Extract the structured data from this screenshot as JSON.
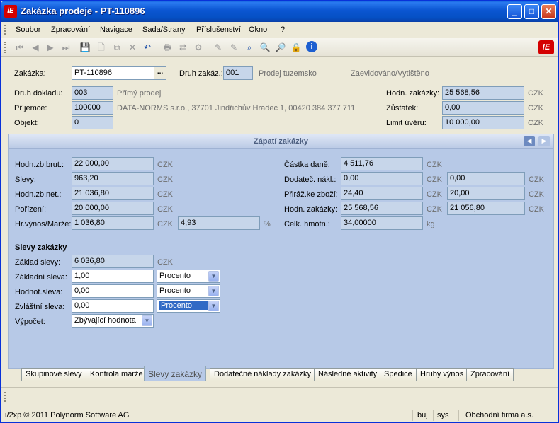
{
  "window": {
    "title": "Zakázka prodeje - PT-110896",
    "icon_text": "iE",
    "buttons": {
      "minimize": "_",
      "maximize": "□",
      "close": "✕"
    }
  },
  "menu": [
    "Soubor",
    "Zpracování",
    "Navigace",
    "Sada/Strany",
    "Příslušenství",
    "Okno",
    "?"
  ],
  "toolbar": {
    "icons": [
      "first-icon",
      "prev-icon",
      "next-icon",
      "last-icon",
      "save-icon",
      "new-icon",
      "copy-icon",
      "delete-icon",
      "undo-icon",
      "print-icon",
      "transfer-icon",
      "settings-icon",
      "edit-icon",
      "edit2-icon",
      "search-icon",
      "zoom-icon",
      "zoom-text-icon",
      "lock-icon",
      "info-icon"
    ],
    "logo_text": "iE"
  },
  "header": {
    "zakazka_label": "Zakázka:",
    "zakazka_value": "PT-110896",
    "druh_zakaz_label": "Druh zakáz.:",
    "druh_zakaz_value": "001",
    "druh_zakaz_desc": "Prodej tuzemsko",
    "status_text": "Zaevidováno/Vytištěno",
    "druh_dokladu_label": "Druh dokladu:",
    "druh_dokladu_value": "003",
    "druh_dokladu_desc": "Přímý prodej",
    "prijemce_label": "Příjemce:",
    "prijemce_value": "100000",
    "prijemce_desc": "DATA-NORMS s.r.o., 37701 Jindřichův Hradec 1, 00420 384 377 711",
    "objekt_label": "Objekt:",
    "objekt_value": "0",
    "hodn_zakazky_label": "Hodn. zakázky:",
    "hodn_zakazky_value": "25 568,56",
    "zustatek_label": "Zůstatek:",
    "zustatek_value": "0,00",
    "limit_label": "Limit úvěru:",
    "limit_value": "10 000,00",
    "currency": "CZK"
  },
  "panel": {
    "title": "Zápatí zakázky",
    "left": [
      {
        "label": "Hodn.zb.brut.:",
        "value": "22 000,00",
        "unit": "CZK"
      },
      {
        "label": "Slevy:",
        "value": "963,20",
        "unit": "CZK"
      },
      {
        "label": "Hodn.zb.net.:",
        "value": "21 036,80",
        "unit": "CZK"
      },
      {
        "label": "Pořízení:",
        "value": "20 000,00",
        "unit": "CZK"
      },
      {
        "label": "Hr.výnos/Marže:",
        "value": "1 036,80",
        "unit": "CZK",
        "extra": "4,93",
        "extra_unit": "%"
      }
    ],
    "right": [
      {
        "label": "Částka daně:",
        "value": "4 511,76",
        "unit": "CZK"
      },
      {
        "label": "Dodateč. nákl.:",
        "value": "0,00",
        "unit": "CZK",
        "value2": "0,00",
        "unit2": "CZK"
      },
      {
        "label": "Přiráž.ke zboží:",
        "value": "24,40",
        "unit": "CZK",
        "value2": "20,00",
        "unit2": "CZK"
      },
      {
        "label": "Hodn. zakázky:",
        "value": "25 568,56",
        "unit": "CZK",
        "value2": "21 056,80",
        "unit2": "CZK"
      },
      {
        "label": "Celk. hmotn.:",
        "value": "34,00000",
        "unit": "kg"
      }
    ],
    "slevy": {
      "title": "Slevy zakázky",
      "zaklad_label": "Základ slevy:",
      "zaklad_value": "6 036,80",
      "zaklad_unit": "CZK",
      "zakladni_label": "Základní sleva:",
      "zakladni_value": "1,00",
      "zakladni_select": "Procento",
      "hodnot_label": "Hodnot.sleva:",
      "hodnot_value": "0,00",
      "hodnot_select": "Procento",
      "zvlastni_label": "Zvláštní sleva:",
      "zvlastni_value": "0,00",
      "zvlastni_select": "Procento",
      "vypocet_label": "Výpočet:",
      "vypocet_select": "Zbývající hodnota"
    }
  },
  "tabs": [
    "Skupinové slevy",
    "Kontrola marže",
    "Slevy zakázky",
    "Dodatečné náklady zakázky",
    "Následné aktivity",
    "Spedice",
    "Hrubý výnos",
    "Zpracování"
  ],
  "status": {
    "copyright": "i/2xp © 2011 Polynorm Software AG",
    "user": "buj",
    "db": "sys",
    "firm": "Obchodní firma a.s."
  }
}
